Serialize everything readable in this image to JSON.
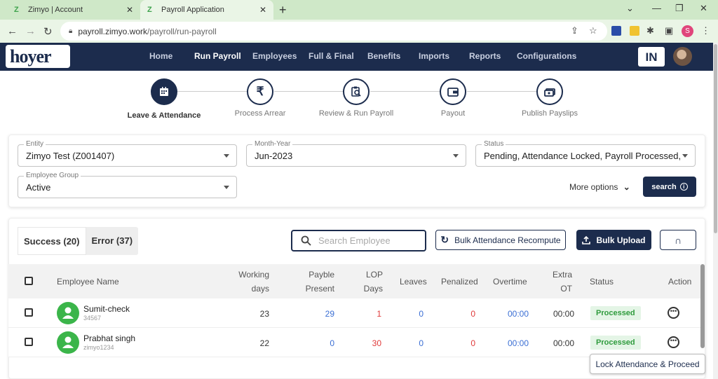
{
  "browser": {
    "tabs": [
      {
        "title": "Zimyo | Account",
        "active": false
      },
      {
        "title": "Payroll Application",
        "active": true
      }
    ],
    "new_tab_icon": "+",
    "url_host": "payroll.zimyo.work",
    "url_path": "/payroll/run-payroll",
    "profile_initial": "S"
  },
  "app": {
    "logo_text": "hoyer",
    "nav": [
      {
        "label": "Home",
        "current": false
      },
      {
        "label": "Run Payroll",
        "current": true
      },
      {
        "label": "Employees",
        "current": false
      },
      {
        "label": "Full & Final",
        "current": false
      },
      {
        "label": "Benefits",
        "current": false
      },
      {
        "label": "Imports",
        "current": false
      },
      {
        "label": "Reports",
        "current": false
      },
      {
        "label": "Configurations",
        "current": false
      }
    ],
    "country_badge": "IN"
  },
  "stepper": [
    {
      "label": "Leave & Attendance",
      "icon": "calendar-icon",
      "current": true
    },
    {
      "label": "Process Arrear",
      "icon": "rupee-icon",
      "current": false
    },
    {
      "label": "Review & Run Payroll",
      "icon": "review-icon",
      "current": false
    },
    {
      "label": "Payout",
      "icon": "wallet-icon",
      "current": false
    },
    {
      "label": "Publish Payslips",
      "icon": "payslip-icon",
      "current": false
    }
  ],
  "filters": {
    "entity": {
      "label": "Entity",
      "value": "Zimyo Test (Z001407)"
    },
    "month_year": {
      "label": "Month-Year",
      "value": "Jun-2023"
    },
    "status": {
      "label": "Status",
      "value": "Pending, Attendance Locked, Payroll Processed,..."
    },
    "employee_group": {
      "label": "Employee Group",
      "value": "Active"
    },
    "more_options": "More options",
    "search_label": "search"
  },
  "results": {
    "tabs": [
      {
        "label": "Success (20)",
        "selected": true
      },
      {
        "label": "Error (37)",
        "selected": false
      }
    ],
    "search_placeholder": "Search Employee",
    "bulk_recompute": "Bulk Attendance Recompute",
    "bulk_upload": "Bulk Upload",
    "columns": {
      "employee_name": "Employee Name",
      "working_days": [
        "Working",
        "days"
      ],
      "payble_present": [
        "Payble",
        "Present"
      ],
      "lop_days": [
        "LOP",
        "Days"
      ],
      "leaves": "Leaves",
      "penalized": "Penalized",
      "overtime": "Overtime",
      "extra_ot": [
        "Extra",
        "OT"
      ],
      "status": "Status",
      "action": "Action"
    },
    "rows": [
      {
        "name": "Sumit-check",
        "id": "34567",
        "working_days": "23",
        "payble_present": "29",
        "lop_days": "1",
        "leaves": "0",
        "penalized": "0",
        "overtime": "00:00",
        "extra_ot": "00:00",
        "status": "Processed"
      },
      {
        "name": "Prabhat singh",
        "id": "zimyo1234",
        "working_days": "22",
        "payble_present": "0",
        "lop_days": "30",
        "leaves": "0",
        "penalized": "0",
        "overtime": "00:00",
        "extra_ot": "00:00",
        "status": "Processed"
      }
    ],
    "lock_button": "Lock Attendance & Proceed"
  },
  "colors": {
    "navy": "#1c2c4d",
    "green": "#3bb54a",
    "blue_value": "#3b6fd4",
    "red_value": "#e03a3a"
  }
}
